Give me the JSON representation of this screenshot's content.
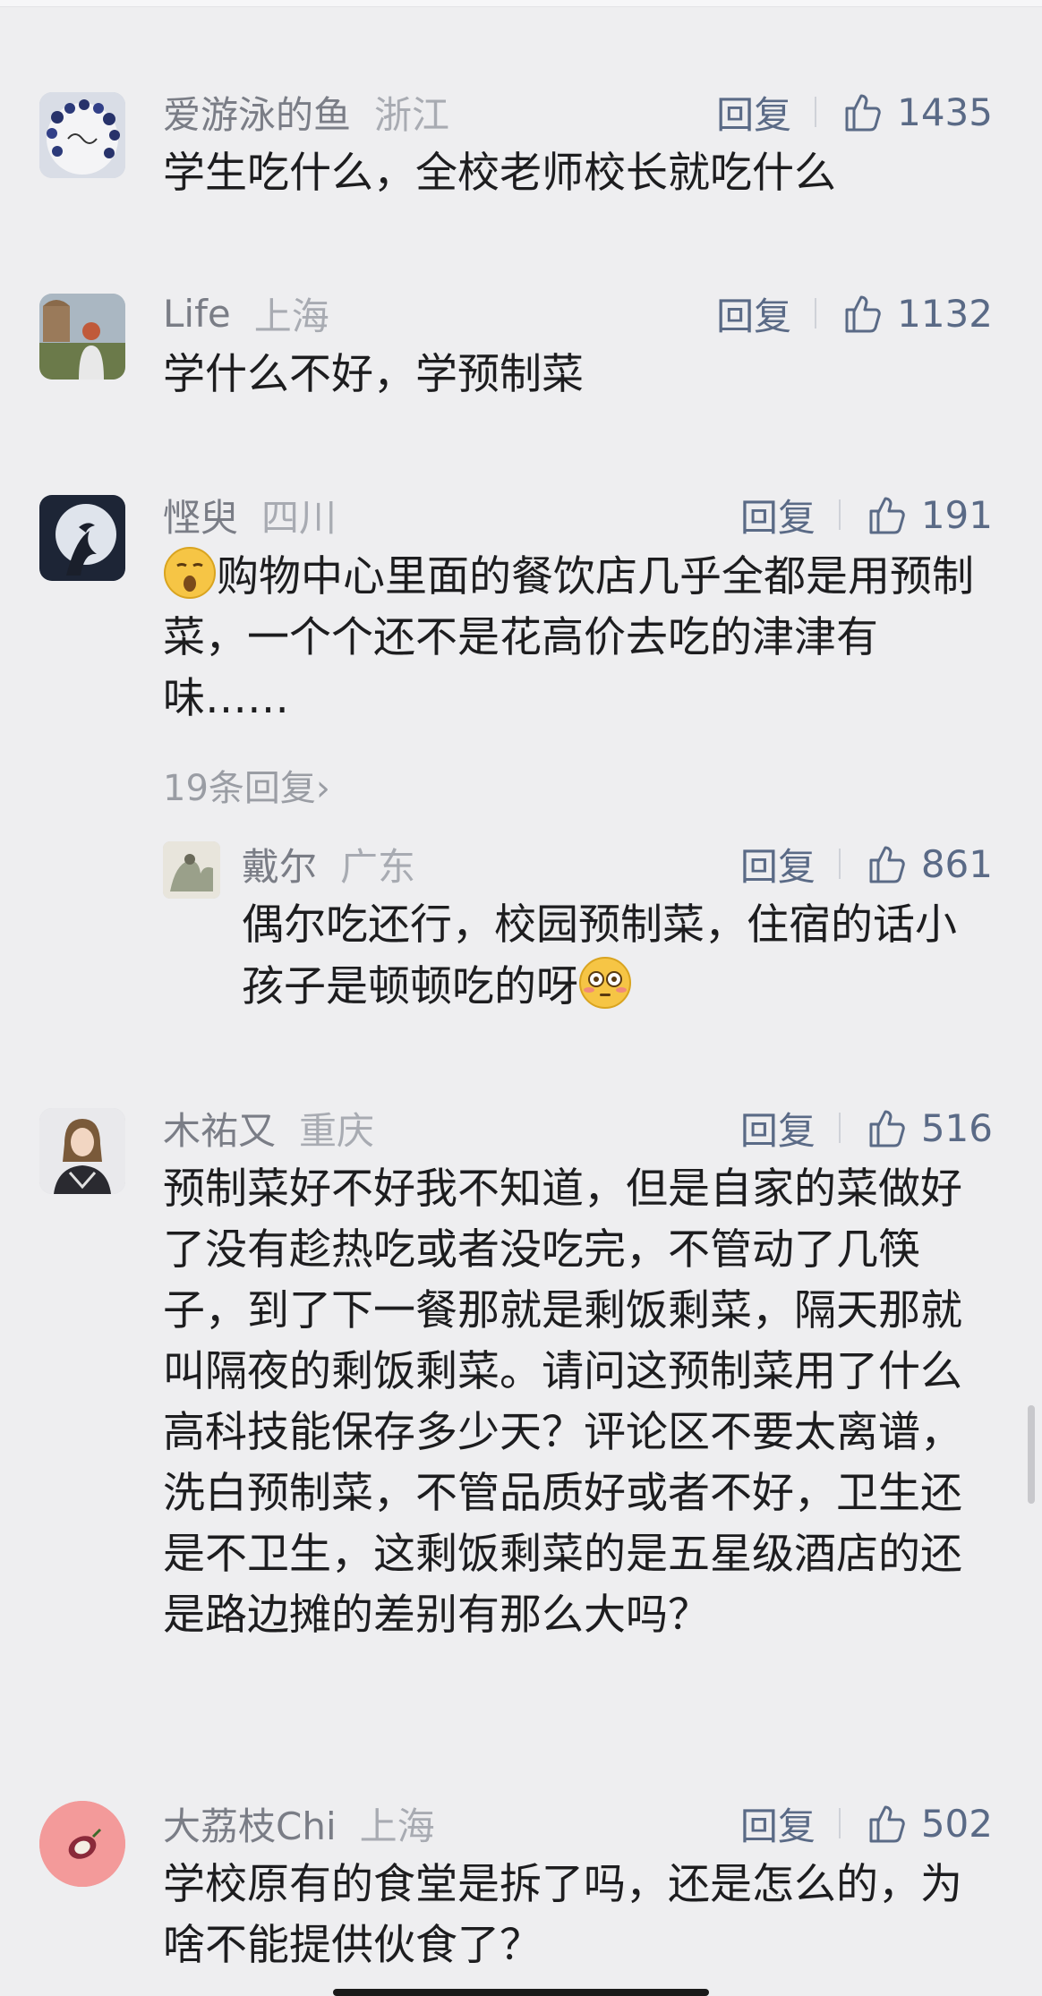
{
  "comments": [
    {
      "nickname": "爱游泳的鱼",
      "location": "浙江",
      "reply_label": "回复",
      "likes": "1435",
      "text": "学生吃什么，全校老师校长就吃什么"
    },
    {
      "nickname": "Life",
      "location": "上海",
      "reply_label": "回复",
      "likes": "1132",
      "text": "学什么不好，学预制菜"
    },
    {
      "nickname": "悭臾",
      "location": "四川",
      "reply_label": "回复",
      "likes": "191",
      "emoji": "smirk-emoji",
      "text": "购物中心里面的餐饮店几乎全都是用预制菜，一个个还不是花高价去吃的津津有味……",
      "more_replies": "19条回复›",
      "reply": {
        "nickname": "戴尔",
        "location": "广东",
        "reply_label": "回复",
        "likes": "861",
        "text": "偶尔吃还行，校园预制菜，住宿的话小孩子是顿顿吃的呀",
        "emoji": "flushed-emoji"
      }
    },
    {
      "nickname": "木祐又",
      "location": "重庆",
      "reply_label": "回复",
      "likes": "516",
      "text": "预制菜好不好我不知道，但是自家的菜做好了没有趁热吃或者没吃完，不管动了几筷子，到了下一餐那就是剩饭剩菜，隔天那就叫隔夜的剩饭剩菜。请问这预制菜用了什么高科技能保存多少天？评论区不要太离谱，洗白预制菜，不管品质好或者不好，卫生还是不卫生，这剩饭剩菜的是五星级酒店的还是路边摊的差别有那么大吗？"
    },
    {
      "nickname": "大荔枝Chi",
      "location": "上海",
      "reply_label": "回复",
      "likes": "502",
      "text": "学校原有的食堂是拆了吗，还是怎么的，为啥不能提供伙食了？"
    }
  ],
  "colors": {
    "background": "#eeeef0",
    "nickname": "#7a7d86",
    "location": "#a8abb2",
    "action": "#5a6a86",
    "body_text": "#1d1d1f"
  }
}
